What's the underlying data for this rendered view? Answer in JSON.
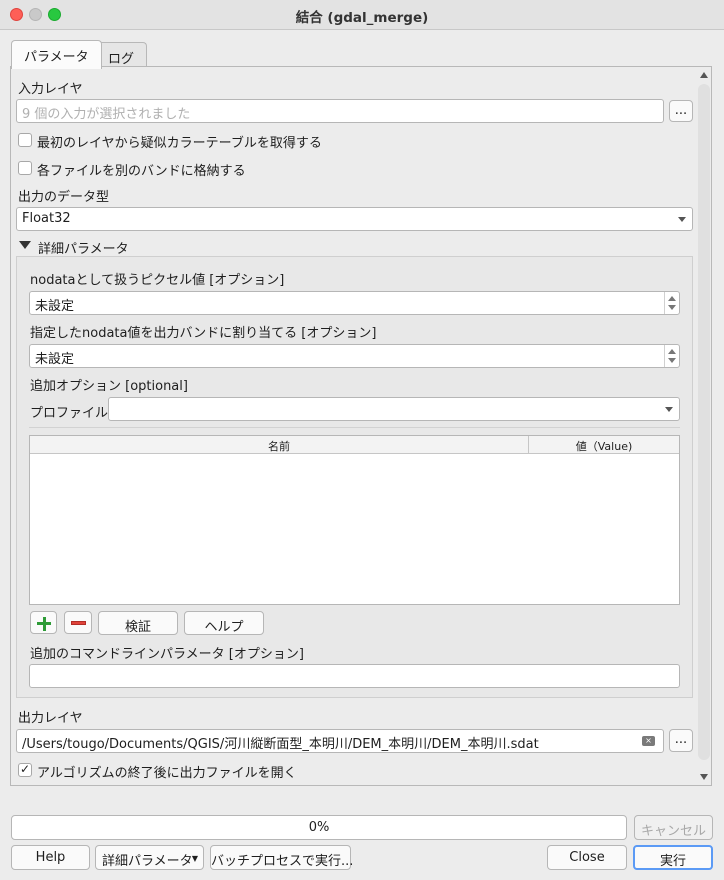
{
  "window": {
    "title": "結合 (gdal_merge)"
  },
  "tabs": [
    {
      "label": "パラメータ",
      "active": true
    },
    {
      "label": "ログ",
      "active": false
    }
  ],
  "input_layer": {
    "label": "入力レイヤ",
    "placeholder": "9 個の入力が選択されました",
    "browse_label": "..."
  },
  "options": {
    "pct_label": "最初のレイヤから疑似カラーテーブルを取得する",
    "pct_checked": false,
    "separate_label": "各ファイルを別のバンドに格納する",
    "separate_checked": false
  },
  "data_type": {
    "label": "出力のデータ型",
    "value": "Float32"
  },
  "advanced": {
    "header_label": "詳細パラメータ",
    "expanded": true,
    "nodata_input": {
      "label": "nodataとして扱うピクセル値 [オプション]",
      "value": "未設定"
    },
    "nodata_output": {
      "label": "指定したnodata値を出力バンドに割り当てる [オプション]",
      "value": "未設定"
    },
    "creation_options": {
      "label": "追加オプション [optional]",
      "profile_label": "プロファイル",
      "profile_value": "",
      "columns": [
        "名前",
        "値（Value)"
      ],
      "rows": [],
      "validate_label": "検証",
      "help_label": "ヘルプ"
    },
    "extra_cmd": {
      "label": "追加のコマンドラインパラメータ [オプション]",
      "value": ""
    }
  },
  "output": {
    "label": "出力レイヤ",
    "path": "/Users/tougo/Documents/QGIS/河川縦断面型_本明川/DEM_本明川/DEM_本明川.sdat",
    "browse_label": "...",
    "open_label": "アルゴリズムの終了後に出力ファイルを開く",
    "open_checked": true
  },
  "progress": {
    "value": 0,
    "text": "0%",
    "cancel_label": "キャンセル"
  },
  "footer": {
    "help_label": "Help",
    "advanced_label": "詳細パラメータ",
    "batch_label": "バッチプロセスで実行...",
    "close_label": "Close",
    "run_label": "実行"
  },
  "colors": {
    "accent": "#3b82f6",
    "traffic_red": "#fe5f57",
    "traffic_yellow": "#febc2e",
    "traffic_green": "#28c840"
  }
}
